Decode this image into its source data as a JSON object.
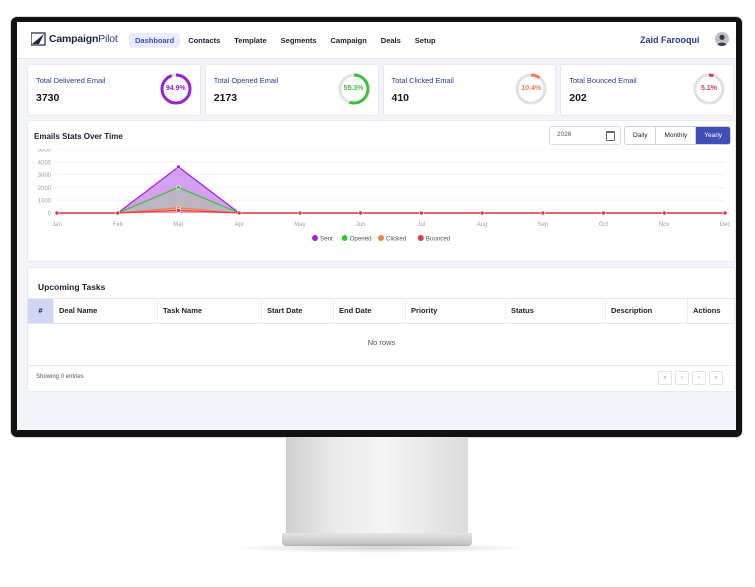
{
  "app": {
    "logo_bold": "Campaign",
    "logo_thin": "Pilot",
    "user_name": "Zaid Farooqui"
  },
  "nav": {
    "items": [
      {
        "label": "Dashboard",
        "active": true
      },
      {
        "label": "Contacts",
        "active": false
      },
      {
        "label": "Template",
        "active": false
      },
      {
        "label": "Segments",
        "active": false
      },
      {
        "label": "Campaign",
        "active": false
      },
      {
        "label": "Deals",
        "active": false
      },
      {
        "label": "Setup",
        "active": false
      }
    ]
  },
  "stats": [
    {
      "title": "Total Delivered Email",
      "value": "3730",
      "percent_label": "94.9%",
      "percent": 94.9,
      "color": "#9b1fd6"
    },
    {
      "title": "Total Opened Email",
      "value": "2173",
      "percent_label": "55.3%",
      "percent": 55.3,
      "color": "#3cc23a"
    },
    {
      "title": "Total Clicked Email",
      "value": "410",
      "percent_label": "10.4%",
      "percent": 10.4,
      "color": "#f07e4c"
    },
    {
      "title": "Total Bounced Email",
      "value": "202",
      "percent_label": "5.1%",
      "percent": 5.1,
      "color": "#e0384f"
    }
  ],
  "chart_panel": {
    "title": "Emails Stats Over Time",
    "year": "2026",
    "periods": [
      {
        "label": "Daily",
        "active": false
      },
      {
        "label": "Monthly",
        "active": false
      },
      {
        "label": "Yearly",
        "active": true
      }
    ]
  },
  "chart_data": {
    "type": "area",
    "title": "Emails Stats Over Time",
    "categories": [
      "Jan",
      "Feb",
      "Mar",
      "Apr",
      "May",
      "Jun",
      "Jul",
      "Aug",
      "Sep",
      "Oct",
      "Nov",
      "Dec"
    ],
    "y_ticks": [
      0,
      1000,
      2000,
      3000,
      4000,
      5000
    ],
    "ylim": [
      0,
      5000
    ],
    "grid": true,
    "legend_position": "bottom",
    "series": [
      {
        "name": "Sent",
        "color": "#a21fe0",
        "fill": "#cf8ef0",
        "values": [
          0,
          0,
          3600,
          0,
          0,
          0,
          0,
          0,
          0,
          0,
          0,
          0
        ]
      },
      {
        "name": "Opened",
        "color": "#3cc23a",
        "fill": "#b9b9b9",
        "values": [
          0,
          0,
          2000,
          0,
          0,
          0,
          0,
          0,
          0,
          0,
          0,
          0
        ]
      },
      {
        "name": "Clicked",
        "color": "#f07e4c",
        "fill": "#f4b49a",
        "values": [
          0,
          0,
          400,
          0,
          0,
          0,
          0,
          0,
          0,
          0,
          0,
          0
        ]
      },
      {
        "name": "Bounced",
        "color": "#e0384f",
        "fill": "#f0a0aa",
        "values": [
          0,
          0,
          200,
          0,
          0,
          0,
          0,
          0,
          0,
          0,
          0,
          0
        ]
      }
    ]
  },
  "tasks": {
    "title": "Upcoming Tasks",
    "columns": [
      "#",
      "Deal Name",
      "Task Name",
      "Start Date",
      "End Date",
      "Priority",
      "Status",
      "Description",
      "Actions"
    ],
    "empty_text": "No rows",
    "showing_text": "Showing 0 entries",
    "pager": [
      "«",
      "‹",
      "›",
      "»"
    ]
  }
}
